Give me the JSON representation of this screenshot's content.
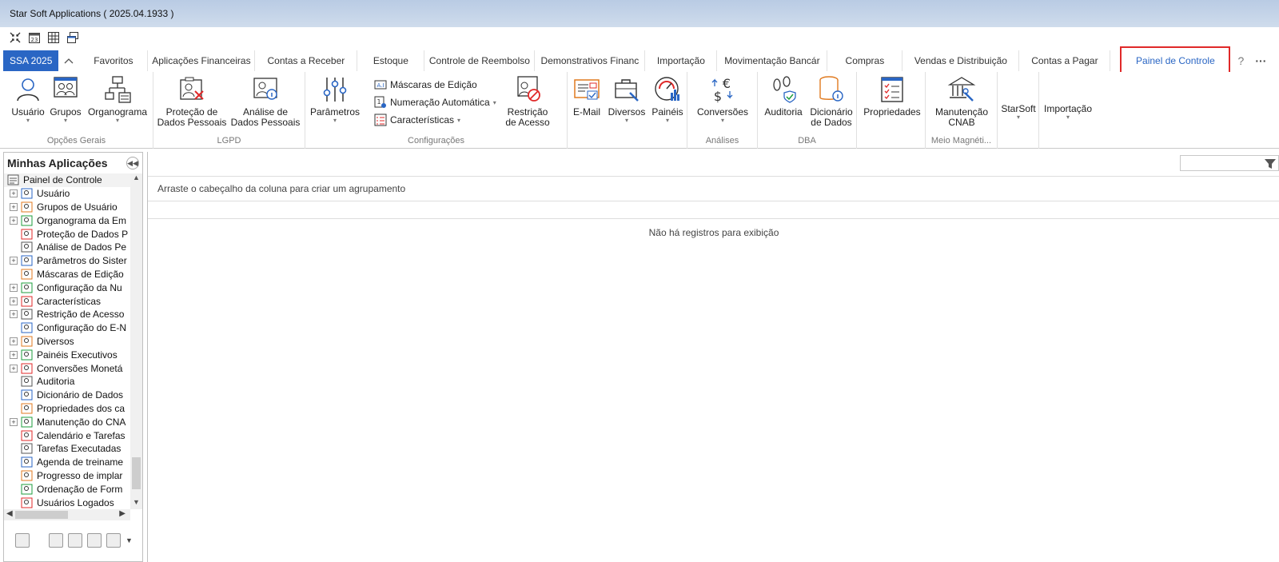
{
  "window": {
    "title": "Star Soft Applications ( 2025.04.1933 )"
  },
  "qat": [
    "compress-icon",
    "calendar-icon",
    "grid-icon",
    "windows-icon"
  ],
  "tabs": {
    "app_tab": "SSA 2025",
    "items": [
      {
        "label": "Favoritos",
        "w": 0
      },
      {
        "label": "Aplicações Financeiras"
      },
      {
        "label": "Contas a Receber"
      },
      {
        "label": "Estoque"
      },
      {
        "label": "Controle de Reembolso"
      },
      {
        "label": "Demonstrativos Financ"
      },
      {
        "label": "Importação"
      },
      {
        "label": "Movimentação Bancár"
      },
      {
        "label": "Compras"
      },
      {
        "label": "Vendas e Distribuição"
      },
      {
        "label": "Contas a Pagar"
      },
      {
        "label": "Painel de Controle"
      }
    ],
    "help": "?",
    "more": "···"
  },
  "ribbon": {
    "groups": {
      "opcoes_gerais": "Opções Gerais",
      "lgpd": "LGPD",
      "configuracoes": "Configurações",
      "analises": "Análises",
      "dba": "DBA",
      "meio_magnetico": "Meio Magnéti..."
    },
    "buttons": {
      "usuario": "Usuário",
      "grupos": "Grupos",
      "organograma": "Organograma",
      "protecao": "Proteção de\nDados Pessoais",
      "analise": "Análise de\nDados Pessoais",
      "parametros": "Parâmetros",
      "mascaras": "Máscaras de Edição",
      "numeracao": "Numeração Automática",
      "caracteristicas": "Características",
      "restricao": "Restrição\nde Acesso",
      "email": "E-Mail",
      "diversos": "Diversos",
      "paineis": "Painéis",
      "conversoes": "Conversões",
      "auditoria": "Auditoria",
      "dicionario": "Dicionário\nde Dados",
      "propriedades": "Propriedades",
      "manutencao": "Manutenção\nCNAB",
      "starsoft": "StarSoft",
      "importacao": "Importação"
    }
  },
  "sidebar": {
    "title": "Minhas Aplicações",
    "root": "Painel de Controle",
    "items": [
      {
        "label": "Usuário",
        "exp": true
      },
      {
        "label": "Grupos de Usuário",
        "exp": true
      },
      {
        "label": "Organograma da Em",
        "exp": true
      },
      {
        "label": "Proteção de Dados P",
        "exp": false
      },
      {
        "label": "Análise de Dados Pe",
        "exp": false
      },
      {
        "label": "Parâmetros do Sister",
        "exp": true
      },
      {
        "label": "Máscaras de Edição",
        "exp": false
      },
      {
        "label": "Configuração da Nu",
        "exp": true
      },
      {
        "label": "Características",
        "exp": true
      },
      {
        "label": "Restrição de Acesso",
        "exp": true
      },
      {
        "label": "Configuração do E-N",
        "exp": false
      },
      {
        "label": "Diversos",
        "exp": true
      },
      {
        "label": "Painéis Executivos",
        "exp": true
      },
      {
        "label": "Conversões Monetá",
        "exp": true
      },
      {
        "label": "Auditoria",
        "exp": false
      },
      {
        "label": "Dicionário de Dados",
        "exp": false
      },
      {
        "label": "Propriedades dos ca",
        "exp": false
      },
      {
        "label": "Manutenção do CNA",
        "exp": true
      },
      {
        "label": "Calendário e Tarefas",
        "exp": false
      },
      {
        "label": "Tarefas Executadas",
        "exp": false
      },
      {
        "label": "Agenda de treiname",
        "exp": false
      },
      {
        "label": "Progresso de implar",
        "exp": false
      },
      {
        "label": "Ordenação de Form",
        "exp": false
      },
      {
        "label": "Usuários Logados",
        "exp": false
      }
    ]
  },
  "main": {
    "group_hint": "Arraste o cabeçalho da coluna para criar um agrupamento",
    "empty_message": "Não há registros para exibição"
  },
  "colors": {
    "accent": "#2a66c4",
    "highlight": "#e02929"
  }
}
